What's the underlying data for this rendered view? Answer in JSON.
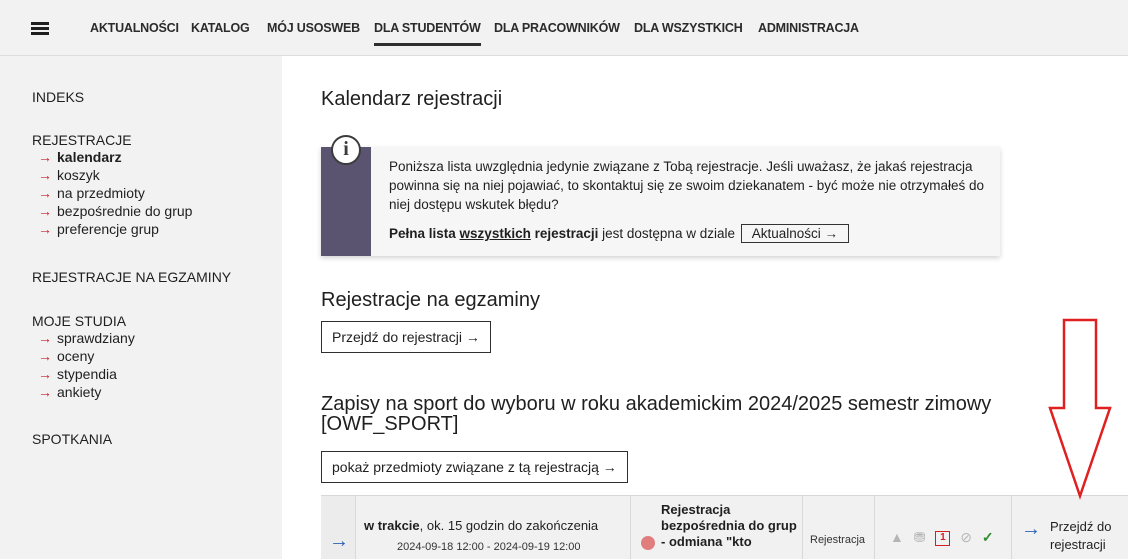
{
  "nav": {
    "items": [
      "AKTUALNOŚCI",
      "KATALOG",
      "MÓJ USOSWEB",
      "DLA STUDENTÓW",
      "DLA PRACOWNIKÓW",
      "DLA WSZYSTKICH",
      "ADMINISTRACJA"
    ],
    "active_index": 3
  },
  "sidebar": {
    "indeks": "INDEKS",
    "rejestracje": "REJESTRACJE",
    "rejestracje_links": [
      "kalendarz",
      "koszyk",
      "na przedmioty",
      "bezpośrednie do grup",
      "preferencje grup"
    ],
    "rejestracje_na_egzaminy": "REJESTRACJE NA EGZAMINY",
    "moje_studia": "MOJE STUDIA",
    "moje_studia_links": [
      "sprawdziany",
      "oceny",
      "stypendia",
      "ankiety"
    ],
    "spotkania": "SPOTKANIA",
    "arrow": "→"
  },
  "main": {
    "title": "Kalendarz rejestracji",
    "info": {
      "text": "Poniższa lista uwzględnia jedynie związane z Tobą rejestracje. Jeśli uważasz, że jakaś rejestracja powinna się na niej pojawiać, to skontaktuj się ze swoim dziekanatem - być może nie otrzymałeś do niej dostępu wskutek błędu?",
      "full_list_a": "Pełna lista ",
      "full_list_link": "wszystkich",
      "full_list_b": " rejestracji",
      "full_list_c": " jest dostępna w dziale",
      "news_button": "Aktualności  →",
      "icon": "info-icon"
    },
    "exams_heading": "Rejestracje na egzaminy",
    "exams_button": "Przejdź do rejestracji  →",
    "sport_heading": "Zapisy na sport do wyboru w roku akademickim 2024/2025 semestr zimowy [OWF_SPORT]",
    "sport_button": "pokaż przedmioty związane z tą rejestracją  →",
    "row": {
      "arrow": "→",
      "status_bold": "w trakcie",
      "status_rest": ", ok. 15 godzin do zakończenia",
      "dates": "2024-09-18 12:00 - 2024-09-19 12:00",
      "name": "Rejestracja bezpośrednia do grup - odmiana \"kto",
      "type": "Rejestracja",
      "box_number": "1",
      "go_arrow": "→",
      "go_text": "Przejdź do rejestracji"
    }
  },
  "colors": {
    "accent_red": "#c8202c",
    "info_stripe": "#5a5470",
    "link_blue": "#2a62b4"
  }
}
